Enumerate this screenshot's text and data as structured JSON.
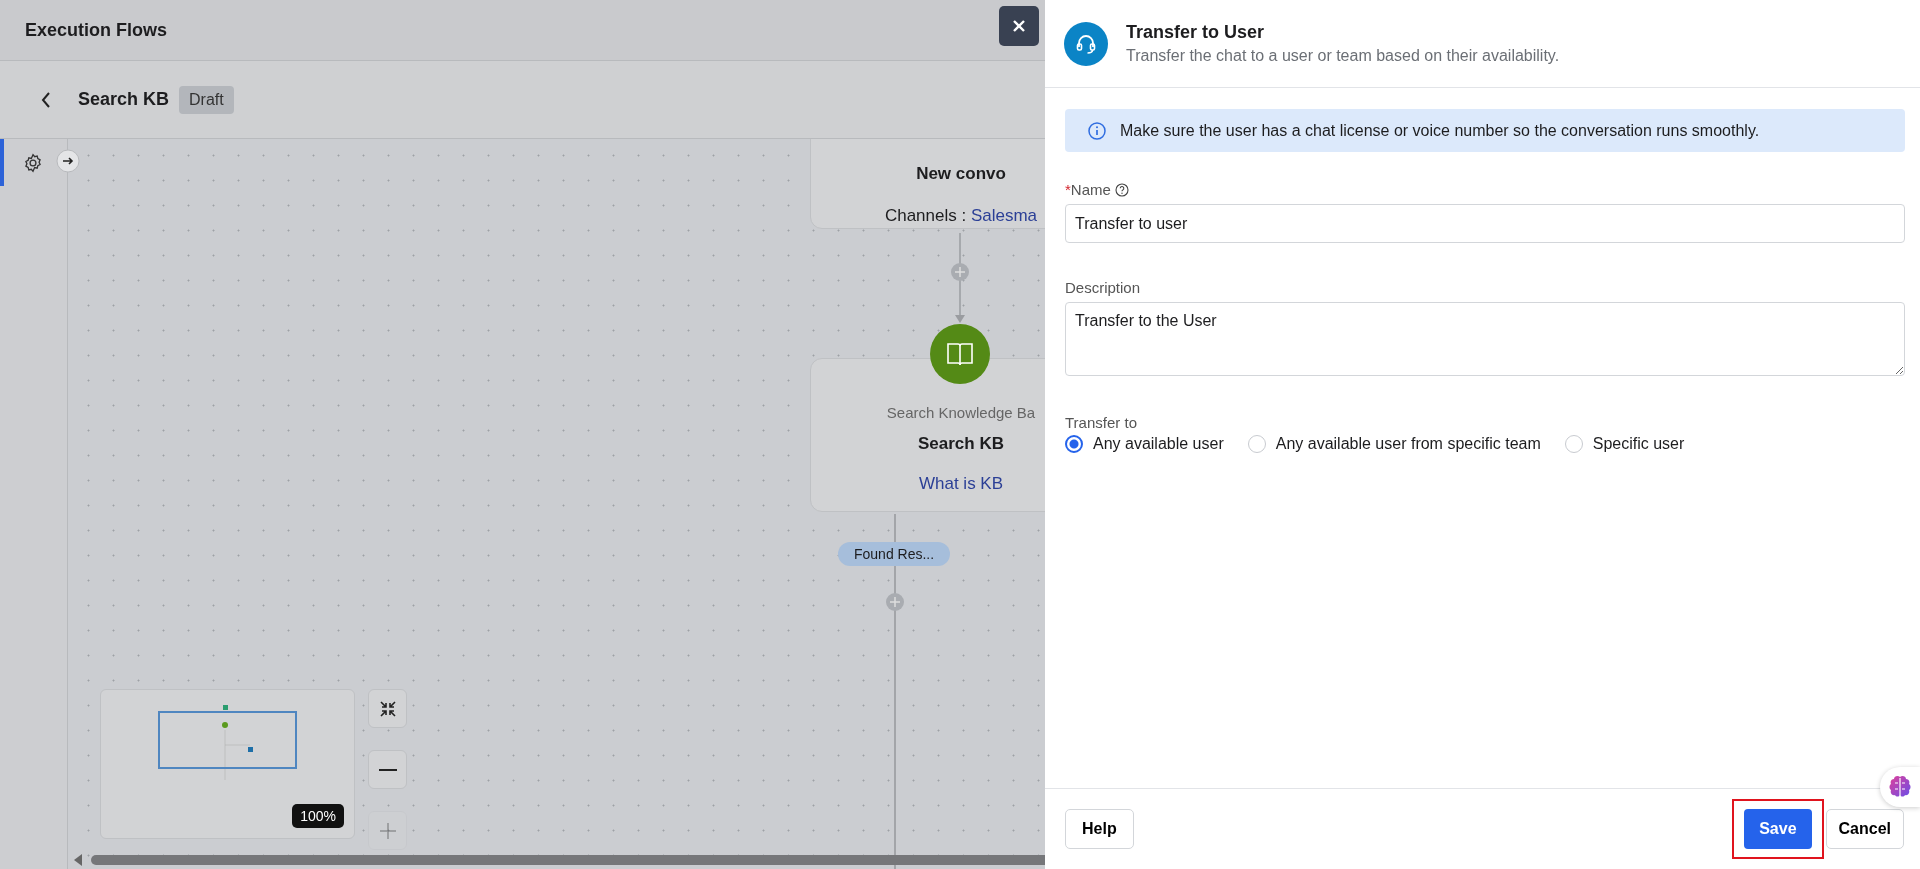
{
  "header": {
    "title": "Execution Flows"
  },
  "flow": {
    "name": "Search KB",
    "status": "Draft"
  },
  "canvas": {
    "nodes": [
      {
        "kind": "trigger",
        "title": "New convo",
        "detail_label": "Channels : ",
        "detail_value": "Salesma"
      },
      {
        "kind": "knowledge",
        "type_label": "Search Knowledge Ba",
        "title": "Search KB",
        "detail_value": "What is KB"
      }
    ],
    "branch_label": "Found Res...",
    "zoom_level": "100%",
    "zoom_controls": [
      {
        "kind": "fit",
        "disabled": false
      },
      {
        "kind": "out",
        "disabled": false
      },
      {
        "kind": "in",
        "disabled": true
      }
    ]
  },
  "panel": {
    "title": "Transfer to User",
    "subtitle": "Transfer the chat to a user or team based on their availability.",
    "notice": "Make sure the user has a chat license or voice number so the conversation runs smoothly.",
    "name_field": {
      "label": "Name",
      "required": true,
      "required_mark": "*",
      "value": "Transfer to user"
    },
    "description_field": {
      "label": "Description",
      "value": "Transfer to the User"
    },
    "transfer_to": {
      "label": "Transfer to",
      "options": [
        {
          "label": "Any available user",
          "selected": true
        },
        {
          "label": "Any available user from specific team",
          "selected": false
        },
        {
          "label": "Specific user",
          "selected": false
        }
      ]
    },
    "buttons": {
      "help": "Help",
      "save": "Save",
      "cancel": "Cancel"
    }
  }
}
